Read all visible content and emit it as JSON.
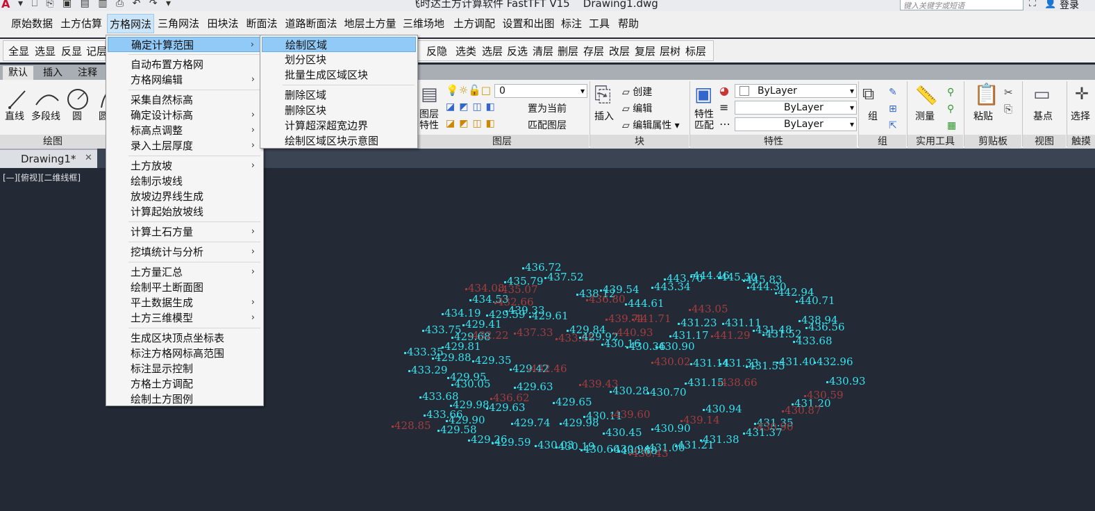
{
  "app": {
    "title": "飞时达土方计算软件 FastTFT V15    Drawing1.dwg",
    "search_placeholder": "键入关键字或短语",
    "login": "登录",
    "quick_access": "▾ ⎕ ⎘ ▣ ▤ ▥ ⎙ ↶ ↷ ▾"
  },
  "menubar": [
    "原始数据",
    "土方估算",
    "方格网法",
    "三角网法",
    "田块法",
    "断面法",
    "道路断面法",
    "地层土方量",
    "三维场地",
    "土方调配",
    "设置和出图",
    "标注",
    "工具",
    "帮助"
  ],
  "toolbar2": {
    "group1": [
      "全显",
      "选显",
      "反显",
      "记层"
    ],
    "group2": [
      "反隐",
      "选类",
      "选层",
      "反选",
      "清层",
      "删层",
      "存层",
      "改层",
      "复层",
      "层树",
      "标层"
    ]
  },
  "ribbon_tabs": [
    "默认",
    "插入",
    "注释"
  ],
  "ribbon": {
    "draw_tools": [
      "直线",
      "多段线",
      "圆",
      "圆"
    ],
    "draw_section": "绘图",
    "layer_value": "0",
    "layer_props": "图层\n特性",
    "layer_buttons": [
      "置为当前",
      "匹配图层"
    ],
    "layer_section": "图层",
    "insert_label": "插入",
    "block_buttons": [
      "创建",
      "编辑",
      "编辑属性"
    ],
    "block_section": "块",
    "props_label": "特性\n匹配",
    "bylayer": [
      "ByLayer",
      "ByLayer",
      "ByLayer"
    ],
    "props_section": "特性",
    "group_label": "组",
    "group_section": "组",
    "measure_label": "测量",
    "util_section": "实用工具",
    "paste_label": "粘贴",
    "clip_section": "剪贴板",
    "base_label": "基点",
    "view_section": "视图",
    "select_label": "选择",
    "touch_section": "触摸"
  },
  "document_tab": "Drawing1*",
  "viewport_label": "[—][俯视][二维线框]",
  "main_menu": {
    "items": [
      {
        "label": "确定计算范围",
        "submenu": true,
        "highlighted": true
      },
      {
        "sep": true
      },
      {
        "label": "自动布置方格网",
        "submenu": false
      },
      {
        "label": "方格网编辑",
        "submenu": true
      },
      {
        "sep": true
      },
      {
        "label": "采集自然标高",
        "submenu": false
      },
      {
        "label": "确定设计标高",
        "submenu": true
      },
      {
        "label": "标高点调整",
        "submenu": true
      },
      {
        "label": "录入土层厚度",
        "submenu": true
      },
      {
        "sep": true
      },
      {
        "label": "土方放坡",
        "submenu": true
      },
      {
        "label": "绘制示坡线",
        "submenu": false
      },
      {
        "label": "放坡边界线生成",
        "submenu": false
      },
      {
        "label": "计算起始放坡线",
        "submenu": false
      },
      {
        "sep": true
      },
      {
        "label": "计算土石方量",
        "submenu": true
      },
      {
        "sep": true
      },
      {
        "label": "挖填统计与分析",
        "submenu": true
      },
      {
        "sep": true
      },
      {
        "label": "土方量汇总",
        "submenu": true
      },
      {
        "label": "绘制平土断面图",
        "submenu": false
      },
      {
        "label": "平土数据生成",
        "submenu": true
      },
      {
        "label": "土方三维模型",
        "submenu": true
      },
      {
        "sep": true
      },
      {
        "label": "生成区块顶点坐标表",
        "submenu": false
      },
      {
        "label": "标注方格网标高范围",
        "submenu": false
      },
      {
        "label": "标注显示控制",
        "submenu": false
      },
      {
        "label": "方格土方调配",
        "submenu": false
      },
      {
        "label": "绘制土方图例",
        "submenu": false
      }
    ]
  },
  "sub_menu": {
    "items": [
      {
        "label": "绘制区域",
        "highlighted": true
      },
      {
        "label": "划分区块"
      },
      {
        "label": "批量生成区域区块"
      },
      {
        "sep": true
      },
      {
        "label": "删除区域"
      },
      {
        "label": "删除区块"
      },
      {
        "label": "计算超深超宽边界"
      },
      {
        "label": "绘制区域区块示意图"
      }
    ]
  },
  "elevation_points": [
    {
      "t": "436.72",
      "c": "c"
    },
    {
      "t": "437.52",
      "c": "c"
    },
    {
      "t": "435.79",
      "c": "c"
    },
    {
      "t": "434.08",
      "c": "r"
    },
    {
      "t": "435.07",
      "c": "r"
    },
    {
      "t": "438.12",
      "c": "c"
    },
    {
      "t": "439.54",
      "c": "c"
    },
    {
      "t": "436.80",
      "c": "r"
    },
    {
      "t": "443.34",
      "c": "c"
    },
    {
      "t": "443.70",
      "c": "c"
    },
    {
      "t": "444.46",
      "c": "c"
    },
    {
      "t": "445.30",
      "c": "c"
    },
    {
      "t": "445.83",
      "c": "c"
    },
    {
      "t": "444.30",
      "c": "c"
    },
    {
      "t": "442.94",
      "c": "c"
    },
    {
      "t": "440.71",
      "c": "c"
    },
    {
      "t": "434.53",
      "c": "c"
    },
    {
      "t": "432.66",
      "c": "r"
    },
    {
      "t": "444.61",
      "c": "c"
    },
    {
      "t": "434.19",
      "c": "c"
    },
    {
      "t": "439.33",
      "c": "c"
    },
    {
      "t": "429.59",
      "c": "c"
    },
    {
      "t": "429.61",
      "c": "c"
    },
    {
      "t": "443.05",
      "c": "r"
    },
    {
      "t": "429.41",
      "c": "c"
    },
    {
      "t": "433.75",
      "c": "c"
    },
    {
      "t": "439.71",
      "c": "r"
    },
    {
      "t": "441.71",
      "c": "r"
    },
    {
      "t": "431.23",
      "c": "c"
    },
    {
      "t": "431.11",
      "c": "c"
    },
    {
      "t": "431.48",
      "c": "c"
    },
    {
      "t": "438.94",
      "c": "c"
    },
    {
      "t": "436.56",
      "c": "c"
    },
    {
      "t": "429.84",
      "c": "c"
    },
    {
      "t": "431.17",
      "c": "c"
    },
    {
      "t": "431.52",
      "c": "c"
    },
    {
      "t": "437.33",
      "c": "r"
    },
    {
      "t": "433.68",
      "c": "r"
    },
    {
      "t": "429.92",
      "c": "c"
    },
    {
      "t": "429.68",
      "c": "c"
    },
    {
      "t": "432.22",
      "c": "r"
    },
    {
      "t": "440.93",
      "c": "r"
    },
    {
      "t": "441.29",
      "c": "r"
    },
    {
      "t": "433.68",
      "c": "c"
    },
    {
      "t": "429.81",
      "c": "c"
    },
    {
      "t": "430.16",
      "c": "c"
    },
    {
      "t": "430.36",
      "c": "c"
    },
    {
      "t": "430.90",
      "c": "c"
    },
    {
      "t": "433.35",
      "c": "c"
    },
    {
      "t": "429.88",
      "c": "c"
    },
    {
      "t": "429.35",
      "c": "c"
    },
    {
      "t": "429.42",
      "c": "c"
    },
    {
      "t": "432.46",
      "c": "r"
    },
    {
      "t": "430.02",
      "c": "r"
    },
    {
      "t": "431.14",
      "c": "c"
    },
    {
      "t": "431.33",
      "c": "c"
    },
    {
      "t": "431.55",
      "c": "c"
    },
    {
      "t": "431.40",
      "c": "c"
    },
    {
      "t": "432.96",
      "c": "c"
    },
    {
      "t": "433.29",
      "c": "c"
    },
    {
      "t": "429.95",
      "c": "c"
    },
    {
      "t": "430.05",
      "c": "c"
    },
    {
      "t": "429.63",
      "c": "c"
    },
    {
      "t": "439.43",
      "c": "r"
    },
    {
      "t": "430.28",
      "c": "c"
    },
    {
      "t": "430.70",
      "c": "c"
    },
    {
      "t": "431.15",
      "c": "c"
    },
    {
      "t": "438.66",
      "c": "r"
    },
    {
      "t": "430.93",
      "c": "c"
    },
    {
      "t": "433.68",
      "c": "c"
    },
    {
      "t": "436.62",
      "c": "r"
    },
    {
      "t": "429.98",
      "c": "c"
    },
    {
      "t": "429.63",
      "c": "c"
    },
    {
      "t": "429.65",
      "c": "c"
    },
    {
      "t": "430.94",
      "c": "c"
    },
    {
      "t": "430.59",
      "c": "r"
    },
    {
      "t": "431.20",
      "c": "c"
    },
    {
      "t": "430.87",
      "c": "r"
    },
    {
      "t": "430.11",
      "c": "c"
    },
    {
      "t": "439.60",
      "c": "r"
    },
    {
      "t": "439.14",
      "c": "r"
    },
    {
      "t": "433.66",
      "c": "c"
    },
    {
      "t": "429.90",
      "c": "c"
    },
    {
      "t": "429.74",
      "c": "c"
    },
    {
      "t": "429.98",
      "c": "c"
    },
    {
      "t": "430.90",
      "c": "c"
    },
    {
      "t": "431.35",
      "c": "c"
    },
    {
      "t": "430.90",
      "c": "r"
    },
    {
      "t": "428.85",
      "c": "r"
    },
    {
      "t": "429.58",
      "c": "c"
    },
    {
      "t": "430.45",
      "c": "c"
    },
    {
      "t": "431.37",
      "c": "c"
    },
    {
      "t": "431.38",
      "c": "c"
    },
    {
      "t": "429.26",
      "c": "c"
    },
    {
      "t": "429.59",
      "c": "c"
    },
    {
      "t": "430.03",
      "c": "c"
    },
    {
      "t": "430.19",
      "c": "c"
    },
    {
      "t": "430.60",
      "c": "c"
    },
    {
      "t": "430.94",
      "c": "c"
    },
    {
      "t": "431.00",
      "c": "c"
    },
    {
      "t": "431.21",
      "c": "c"
    },
    {
      "t": "430.88",
      "c": "c"
    },
    {
      "t": "430.43",
      "c": "r"
    }
  ],
  "colors": {
    "canvas": "#232a36",
    "point_cyan": "#36e3ee",
    "point_red": "#a43d3d",
    "menu_highlight": "#91c9f7"
  }
}
